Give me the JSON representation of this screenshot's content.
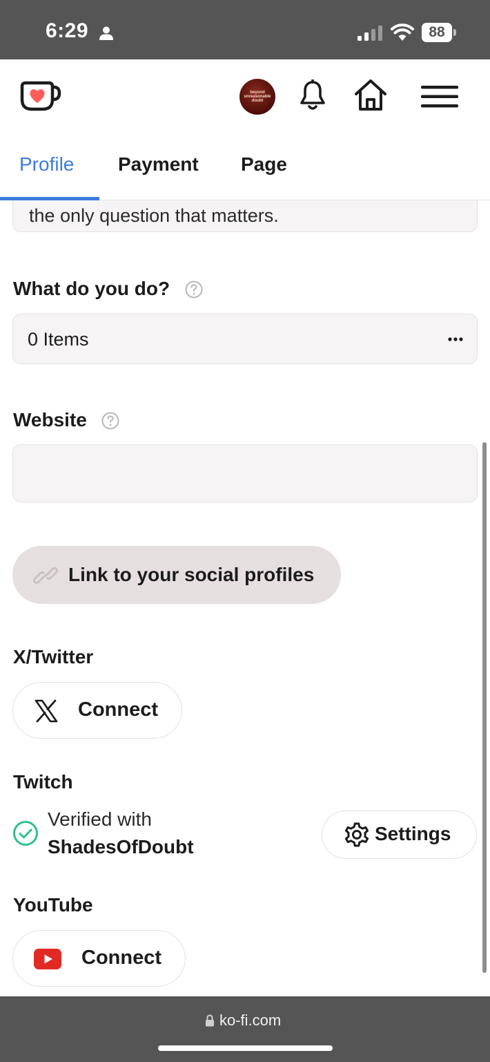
{
  "status_bar": {
    "time": "6:29",
    "battery": "88"
  },
  "nav": {
    "avatar_text": [
      "beyond",
      "unreasonable",
      "doubt"
    ]
  },
  "tabs": [
    {
      "label": "Profile",
      "active": true
    },
    {
      "label": "Payment",
      "active": false
    },
    {
      "label": "Page",
      "active": false
    }
  ],
  "form": {
    "bio_visible_text": "the only question that matters.",
    "what_do_you_do": {
      "label": "What do you do?",
      "value": "0 Items"
    },
    "website": {
      "label": "Website",
      "value": ""
    },
    "social_button_label": "Link to your social profiles",
    "twitter": {
      "label": "X/Twitter",
      "button": "Connect"
    },
    "twitch": {
      "label": "Twitch",
      "verified_prefix": "Verified with",
      "account": "ShadesOfDoubt",
      "settings_label": "Settings"
    },
    "youtube": {
      "label": "YouTube",
      "button": "Connect"
    }
  },
  "url_bar": {
    "url": "ko-fi.com"
  },
  "colors": {
    "accent": "#3d7be0",
    "kofi_red": "#ff5e5b",
    "verified_green": "#2fc08e",
    "youtube_red": "#e12a24",
    "chrome_gray": "#555555"
  }
}
